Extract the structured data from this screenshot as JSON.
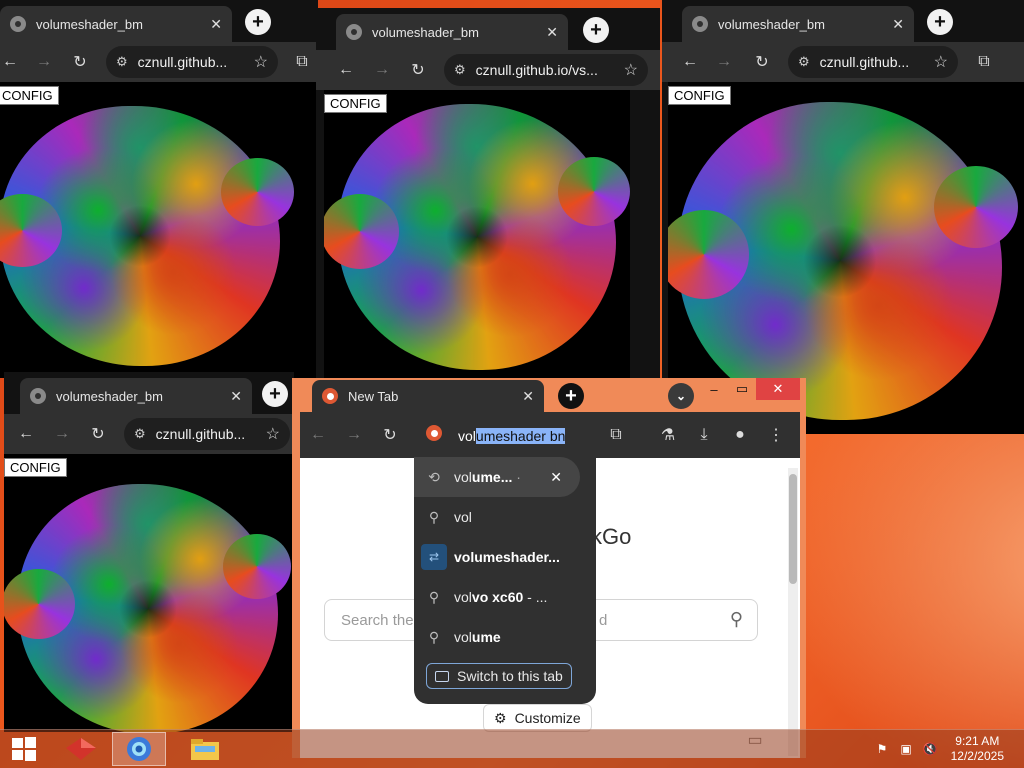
{
  "background_windows": [
    {
      "tab_title": "volumeshader_bm",
      "url": "cznull.github...",
      "config_label": "CONFIG"
    },
    {
      "tab_title": "volumeshader_bm",
      "url": "cznull.github.io/vs...",
      "config_label": "CONFIG"
    },
    {
      "tab_title": "volumeshader_bm",
      "url": "cznull.github...",
      "config_label": "CONFIG"
    },
    {
      "tab_title": "volumeshader_bm",
      "url": "cznull.github...",
      "config_label": "CONFIG"
    }
  ],
  "front_window": {
    "tab_title": "New Tab",
    "address_typed": "vol",
    "address_autocomplete": "umeshader bn",
    "page": {
      "brand_fragment": "ckGo",
      "search_placeholder_start": "Search the",
      "search_placeholder_end": "d",
      "customize_label": "Customize"
    }
  },
  "suggestions": [
    {
      "icon": "history-icon",
      "bold": "ume...",
      "prefix": "vol",
      "suffix": " · "
    },
    {
      "icon": "search-icon",
      "prefix": "vol",
      "bold": "",
      "suffix": ""
    },
    {
      "icon": "tab-icon",
      "prefix": "vol",
      "bold": "umeshader...",
      "suffix": ""
    },
    {
      "icon": "search-icon",
      "prefix": "vol",
      "bold": "vo xc60",
      "suffix": " - ..."
    },
    {
      "icon": "search-icon",
      "prefix": "vol",
      "bold": "ume",
      "suffix": ""
    }
  ],
  "switch_tab_label": "Switch to this tab",
  "clock": {
    "time": "9:21 AM",
    "date": "12/2/2025"
  },
  "colors": {
    "accent_selection": "#8ab4f8",
    "desktop": "#e8541f",
    "duck_brand": "#de5833"
  }
}
